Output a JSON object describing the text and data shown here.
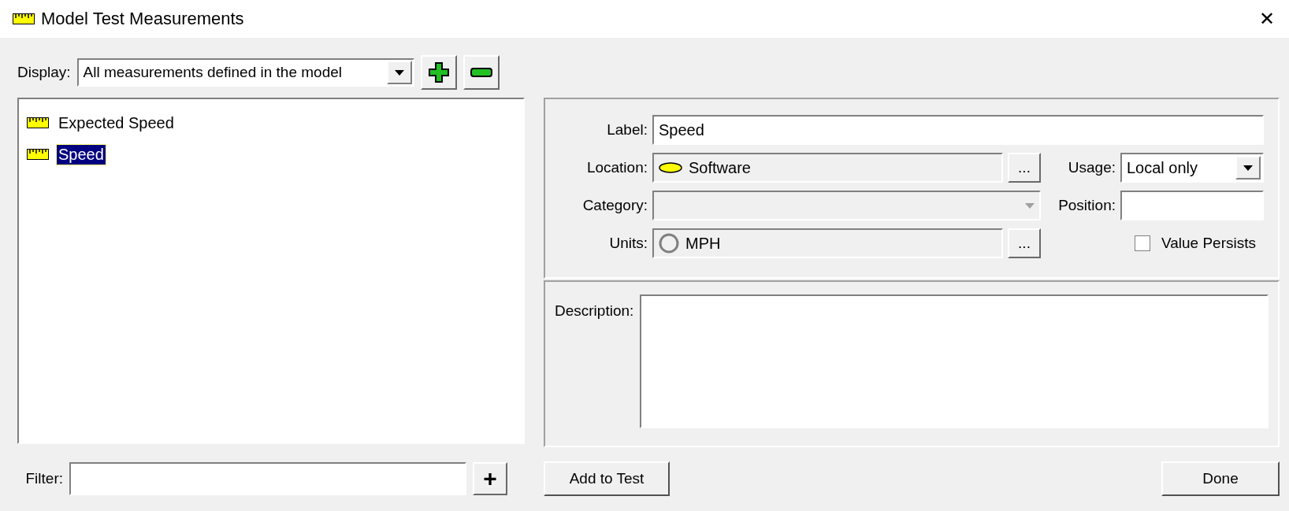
{
  "window": {
    "title": "Model Test Measurements",
    "close": "✕"
  },
  "display": {
    "label": "Display:",
    "value": "All measurements defined in the model"
  },
  "measurements": [
    {
      "label": "Expected Speed",
      "selected": false
    },
    {
      "label": "Speed",
      "selected": true
    }
  ],
  "filter": {
    "label": "Filter:",
    "add": "+"
  },
  "form": {
    "label": {
      "label": "Label:",
      "value": "Speed"
    },
    "location": {
      "label": "Location:",
      "value": "Software",
      "browse": "..."
    },
    "usage": {
      "label": "Usage:",
      "value": "Local only"
    },
    "category": {
      "label": "Category:"
    },
    "position": {
      "label": "Position:"
    },
    "units": {
      "label": "Units:",
      "value": "MPH",
      "browse": "..."
    },
    "value_persists": {
      "label": "Value Persists",
      "checked": false
    },
    "description": {
      "label": "Description:"
    }
  },
  "buttons": {
    "add_to_test": "Add to Test",
    "done": "Done"
  }
}
